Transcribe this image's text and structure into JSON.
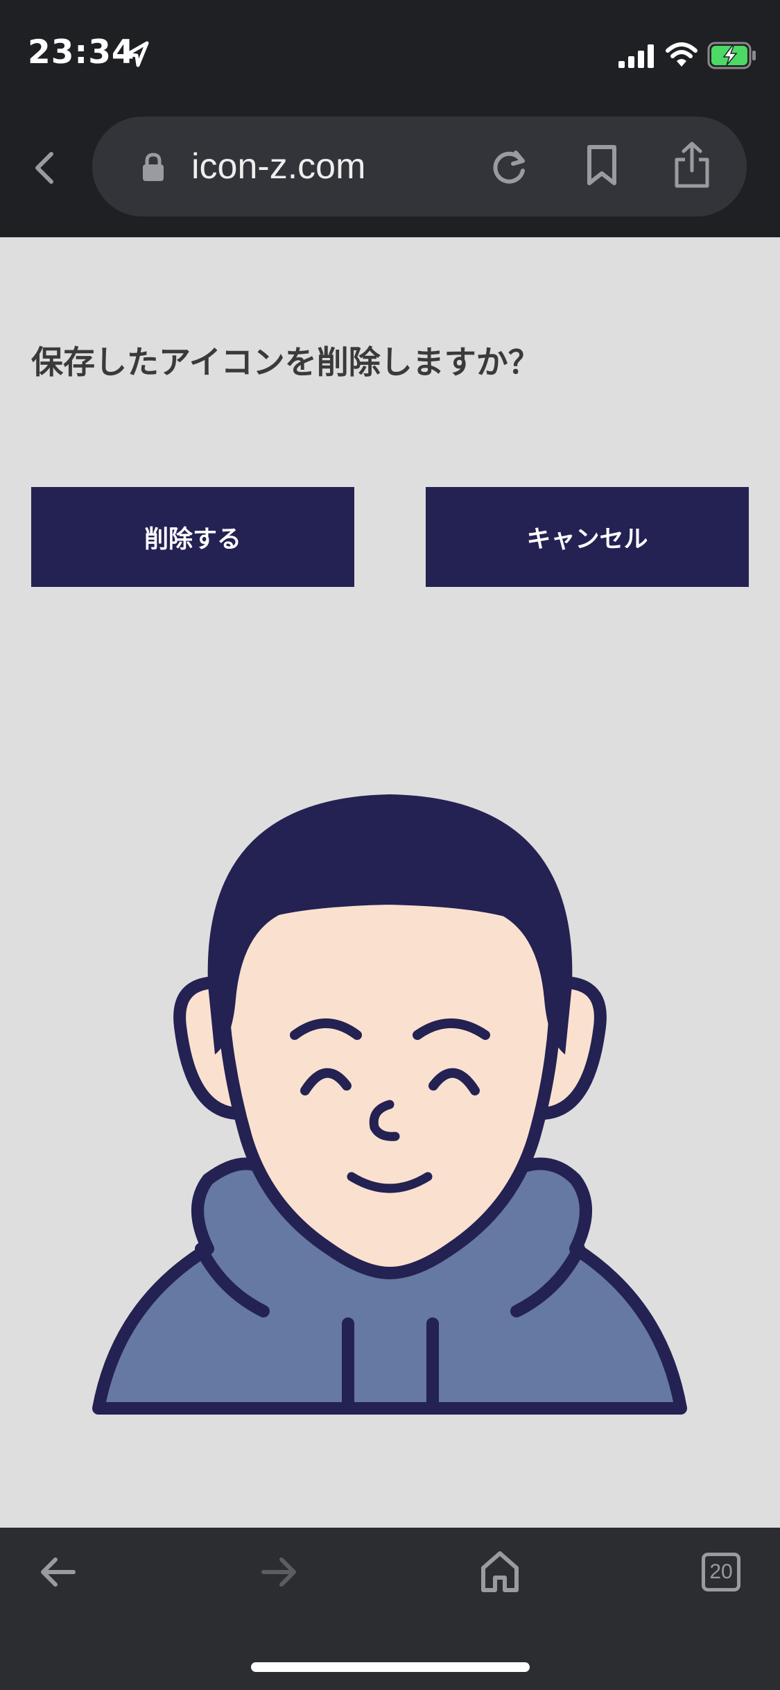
{
  "status_bar": {
    "time": "23:34",
    "icons": [
      "location-arrow-icon",
      "signal-icon",
      "wifi-icon",
      "battery-charging-icon"
    ]
  },
  "browser": {
    "url": "icon-z.com",
    "icons": [
      "back-chevron-icon",
      "lock-icon",
      "reload-icon",
      "bookmark-icon",
      "share-icon"
    ]
  },
  "dialog": {
    "question": "保存したアイコンを削除しますか？",
    "delete_label": "削除する",
    "cancel_label": "キャンセル"
  },
  "avatar": {
    "hair_color": "#242153",
    "skin_color": "#fae1cf",
    "hoodie_color": "#6579a2",
    "outline_color": "#242153"
  },
  "toolbar": {
    "tab_count": "20",
    "icons": [
      "back-arrow-icon",
      "forward-arrow-icon",
      "home-icon",
      "tabs-icon"
    ]
  },
  "colors": {
    "accent": "#242153",
    "page_background": "#dedede",
    "chrome_background": "#1f2024"
  }
}
